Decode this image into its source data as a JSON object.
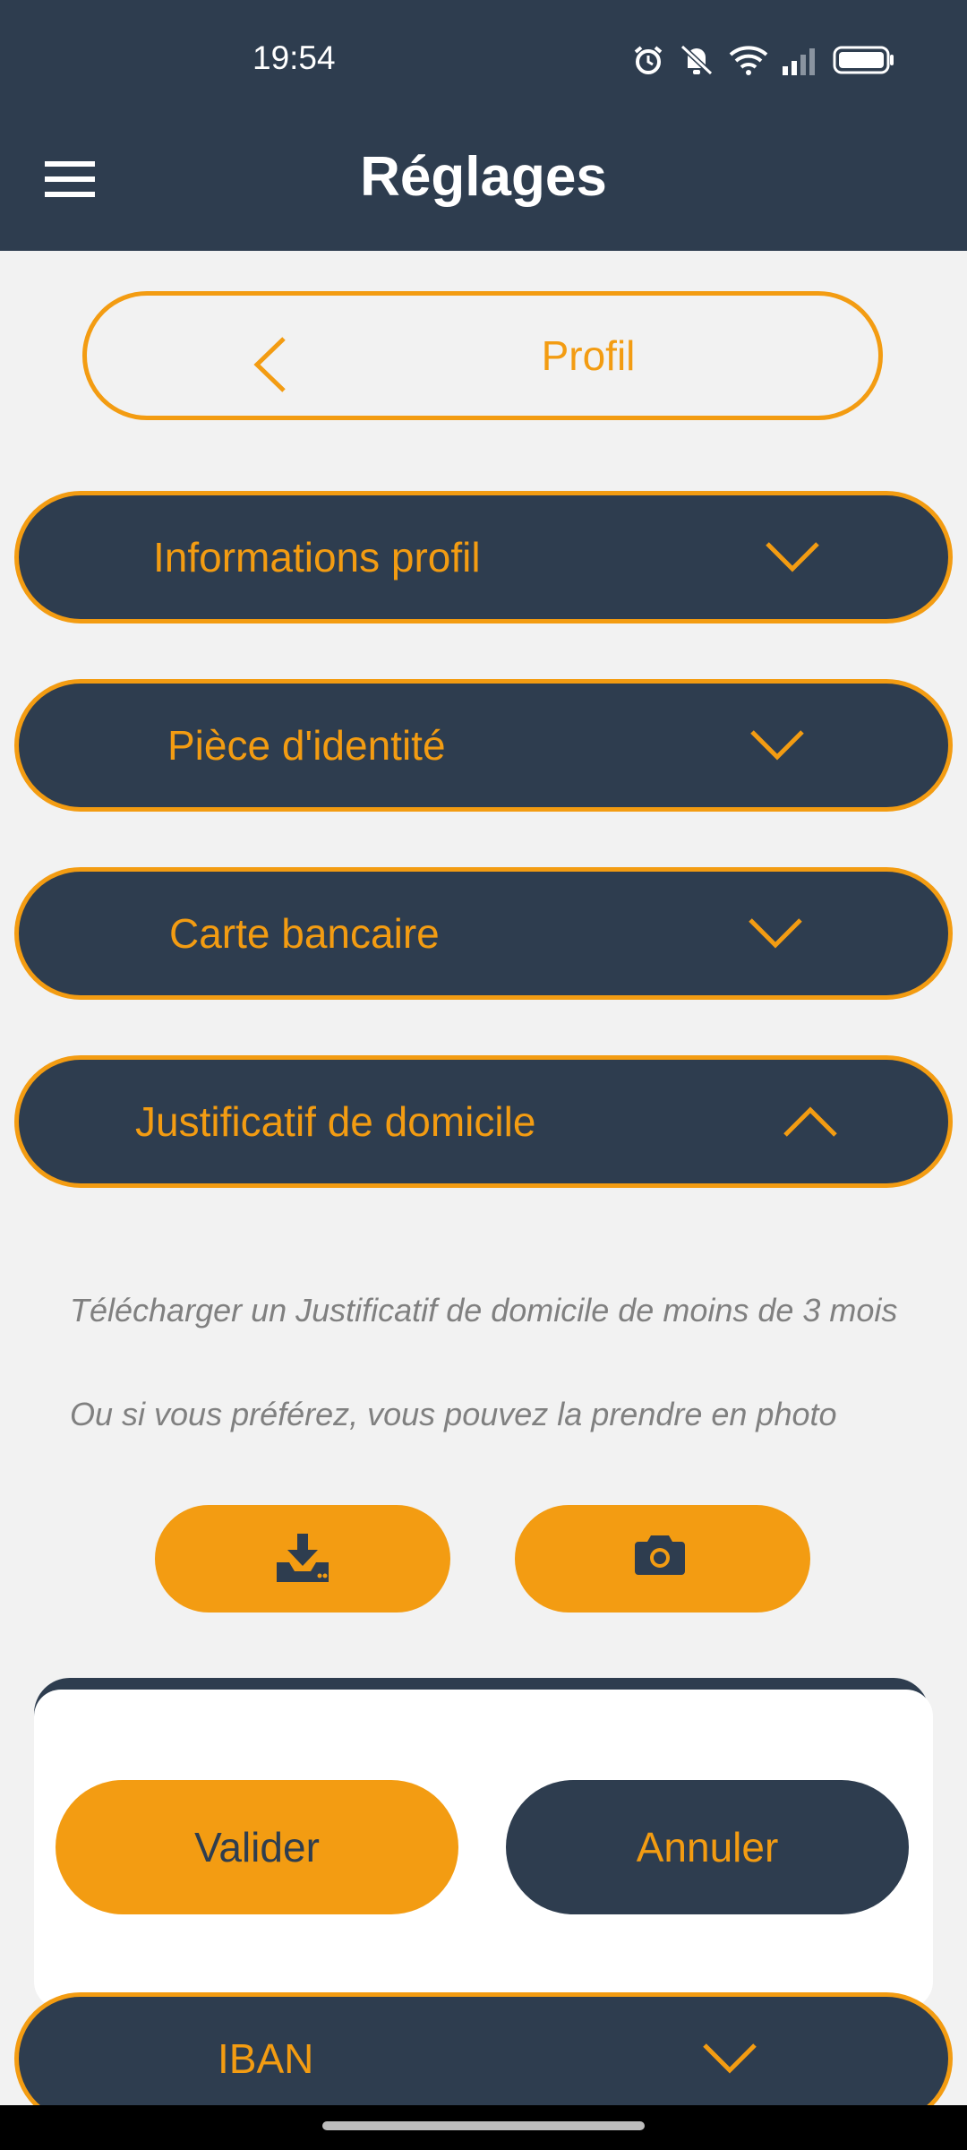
{
  "status_bar": {
    "time": "19:54",
    "icons": [
      "alarm-icon",
      "silent-icon",
      "wifi-icon",
      "signal-icon",
      "battery-icon"
    ]
  },
  "app_bar": {
    "title": "Réglages",
    "menu_icon": "hamburger-menu-icon"
  },
  "profil_nav": {
    "label": "Profil",
    "back_icon": "chevron-left-icon"
  },
  "sections": [
    {
      "label": "Informations profil",
      "expanded": false
    },
    {
      "label": "Pièce d'identité",
      "expanded": false
    },
    {
      "label": "Carte bancaire",
      "expanded": false
    },
    {
      "label": "Justificatif de domicile",
      "expanded": true
    }
  ],
  "justificatif": {
    "description": "Télécharger un Justificatif de domicile de moins de 3 mois",
    "photo_hint": "Ou si vous préférez, vous pouvez la prendre en photo",
    "upload_icon": "download-tray-icon",
    "camera_icon": "camera-icon"
  },
  "dialog": {
    "confirm_label": "Valider",
    "cancel_label": "Annuler"
  },
  "iban_section": {
    "label": "IBAN",
    "expanded": false
  },
  "colors": {
    "accent": "#f39c12",
    "primary": "#2e3d4f",
    "background": "#f2f2f2",
    "muted_text": "#808080"
  }
}
